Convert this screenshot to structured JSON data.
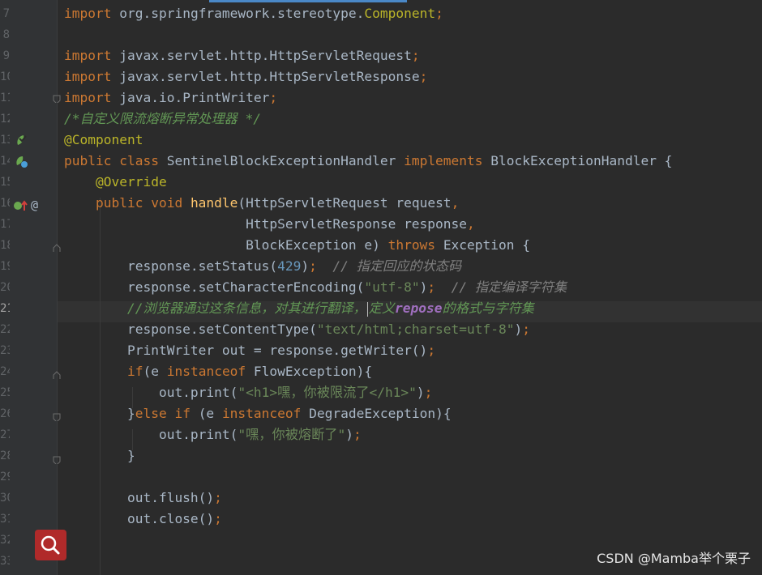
{
  "watermark": "CSDN @Mamba举个栗子",
  "lines": [
    {
      "num": "7",
      "seg": [
        {
          "t": "import ",
          "c": "kw"
        },
        {
          "t": "org.springframework.stereotype.",
          "c": ""
        },
        {
          "t": "Component",
          "c": "ann"
        },
        {
          "t": ";",
          "c": "kw"
        }
      ]
    },
    {
      "num": "8",
      "seg": []
    },
    {
      "num": "9",
      "seg": [
        {
          "t": "import ",
          "c": "kw"
        },
        {
          "t": "javax.servlet.http.HttpServletRequest",
          "c": ""
        },
        {
          "t": ";",
          "c": "kw"
        }
      ]
    },
    {
      "num": "10",
      "seg": [
        {
          "t": "import ",
          "c": "kw"
        },
        {
          "t": "javax.servlet.http.HttpServletResponse",
          "c": ""
        },
        {
          "t": ";",
          "c": "kw"
        }
      ]
    },
    {
      "num": "11",
      "seg": [
        {
          "t": "import ",
          "c": "kw"
        },
        {
          "t": "java.io.PrintWriter",
          "c": ""
        },
        {
          "t": ";",
          "c": "kw"
        }
      ]
    },
    {
      "num": "12",
      "seg": [
        {
          "t": "/*自定义限流熔断异常处理器 */",
          "c": "doc"
        }
      ]
    },
    {
      "num": "13",
      "seg": [
        {
          "t": "@Component",
          "c": "ann"
        }
      ]
    },
    {
      "num": "14",
      "seg": [
        {
          "t": "public class ",
          "c": "kw"
        },
        {
          "t": "SentinelBlockExceptionHandler ",
          "c": ""
        },
        {
          "t": "implements ",
          "c": "kw"
        },
        {
          "t": "BlockExceptionHandler {",
          "c": ""
        }
      ]
    },
    {
      "num": "15",
      "seg": [
        {
          "t": "    ",
          "c": ""
        },
        {
          "t": "@Override",
          "c": "ann"
        }
      ]
    },
    {
      "num": "16",
      "seg": [
        {
          "t": "    ",
          "c": ""
        },
        {
          "t": "public void ",
          "c": "kw"
        },
        {
          "t": "handle",
          "c": "fn"
        },
        {
          "t": "(HttpServletRequest request",
          "c": ""
        },
        {
          "t": ",",
          "c": "kw"
        }
      ]
    },
    {
      "num": "17",
      "seg": [
        {
          "t": "                       HttpServletResponse response",
          "c": ""
        },
        {
          "t": ",",
          "c": "kw"
        }
      ]
    },
    {
      "num": "18",
      "seg": [
        {
          "t": "                       BlockException e) ",
          "c": ""
        },
        {
          "t": "throws ",
          "c": "kw"
        },
        {
          "t": "Exception {",
          "c": ""
        }
      ]
    },
    {
      "num": "19",
      "seg": [
        {
          "t": "        response.setStatus(",
          "c": ""
        },
        {
          "t": "429",
          "c": "num"
        },
        {
          "t": ")",
          "c": ""
        },
        {
          "t": ";  ",
          "c": "kw"
        },
        {
          "t": "// 指定回应的状态码",
          "c": "cm"
        }
      ]
    },
    {
      "num": "20",
      "seg": [
        {
          "t": "        response.setCharacterEncoding(",
          "c": ""
        },
        {
          "t": "\"utf-8\"",
          "c": "str"
        },
        {
          "t": ")",
          "c": ""
        },
        {
          "t": ";  ",
          "c": "kw"
        },
        {
          "t": "// 指定编译字符集",
          "c": "cm"
        }
      ]
    },
    {
      "num": "21",
      "seg": [
        {
          "t": "        ",
          "c": ""
        },
        {
          "t": "//浏览器通过这条信息，对其进行翻译，",
          "c": "doc"
        },
        {
          "t": "",
          "c": "caret"
        },
        {
          "t": "定义",
          "c": "doc"
        },
        {
          "t": "repose",
          "c": "docb"
        },
        {
          "t": "的格式与字符集",
          "c": "doc"
        }
      ]
    },
    {
      "num": "22",
      "seg": [
        {
          "t": "        response.setContentType(",
          "c": ""
        },
        {
          "t": "\"text/html;charset=utf-8\"",
          "c": "str"
        },
        {
          "t": ")",
          "c": ""
        },
        {
          "t": ";",
          "c": "kw"
        }
      ]
    },
    {
      "num": "23",
      "seg": [
        {
          "t": "        PrintWriter out = response.getWriter()",
          "c": ""
        },
        {
          "t": ";",
          "c": "kw"
        }
      ]
    },
    {
      "num": "24",
      "seg": [
        {
          "t": "        ",
          "c": ""
        },
        {
          "t": "if",
          "c": "kw"
        },
        {
          "t": "(e ",
          "c": ""
        },
        {
          "t": "instanceof ",
          "c": "kw"
        },
        {
          "t": "FlowException){",
          "c": ""
        }
      ]
    },
    {
      "num": "25",
      "seg": [
        {
          "t": "            out.print(",
          "c": ""
        },
        {
          "t": "\"<h1>嘿，你被限流了</h1>\"",
          "c": "str"
        },
        {
          "t": ")",
          "c": ""
        },
        {
          "t": ";",
          "c": "kw"
        }
      ]
    },
    {
      "num": "26",
      "seg": [
        {
          "t": "        }",
          "c": ""
        },
        {
          "t": "else if ",
          "c": "kw"
        },
        {
          "t": "(e ",
          "c": ""
        },
        {
          "t": "instanceof ",
          "c": "kw"
        },
        {
          "t": "DegradeException){",
          "c": ""
        }
      ]
    },
    {
      "num": "27",
      "seg": [
        {
          "t": "            out.print(",
          "c": ""
        },
        {
          "t": "\"嘿，你被熔断了\"",
          "c": "str"
        },
        {
          "t": ")",
          "c": ""
        },
        {
          "t": ";",
          "c": "kw"
        }
      ]
    },
    {
      "num": "28",
      "seg": [
        {
          "t": "        }",
          "c": ""
        }
      ]
    },
    {
      "num": "29",
      "seg": []
    },
    {
      "num": "30",
      "seg": [
        {
          "t": "        out.flush()",
          "c": ""
        },
        {
          "t": ";",
          "c": "kw"
        }
      ]
    },
    {
      "num": "31",
      "seg": [
        {
          "t": "        out.close()",
          "c": ""
        },
        {
          "t": ";",
          "c": "kw"
        }
      ]
    },
    {
      "num": "32",
      "seg": []
    },
    {
      "num": "33",
      "seg": []
    }
  ],
  "active_line": "21",
  "gutter_icons": {
    "line13": "bean-icon",
    "line14": "bean-icon",
    "line16_a": "implementing-method-icon",
    "line16_b": "annotation-icon",
    "search": "search-icon"
  },
  "at_symbol": "@",
  "colors": {
    "background": "#2b2b2b",
    "gutter": "#313335",
    "keyword": "#cc7832",
    "annotation": "#bbb529",
    "string": "#6a8759",
    "number": "#6897bb",
    "method": "#ffc66d",
    "comment": "#808080",
    "doc_comment": "#629755",
    "identifier": "#a9b7c6",
    "search_button": "#b02a2a"
  }
}
